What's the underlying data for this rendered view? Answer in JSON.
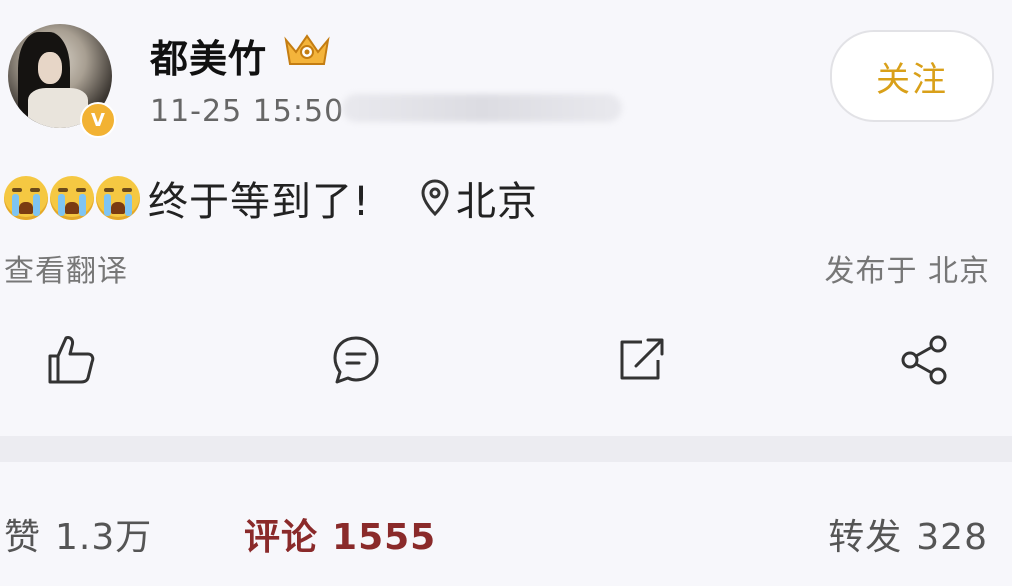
{
  "user": {
    "name": "都美竹",
    "timestamp": "11-25 15:50",
    "verified_badge_icon": "verified-v-icon",
    "member_icon": "crown-icon"
  },
  "follow_label": "关注",
  "post": {
    "emoji_icon": "crying-emoji-icon",
    "emoji_count": 3,
    "text": "终于等到了!",
    "location_icon": "location-pin-icon",
    "location": "北京"
  },
  "translate_label": "查看翻译",
  "published_label": "发布于 北京",
  "actions": {
    "like_icon": "thumbs-up-icon",
    "comment_icon": "comment-icon",
    "repost_icon": "repost-icon",
    "share_icon": "share-icon"
  },
  "stats": {
    "likes_label": "赞",
    "likes_value": "1.3万",
    "comments_label": "评论",
    "comments_value": "1555",
    "reposts_label": "转发",
    "reposts_value": "328"
  },
  "colors": {
    "accent": "#d9a019",
    "comments_active": "#8a2a2a",
    "muted_text": "#777777"
  }
}
